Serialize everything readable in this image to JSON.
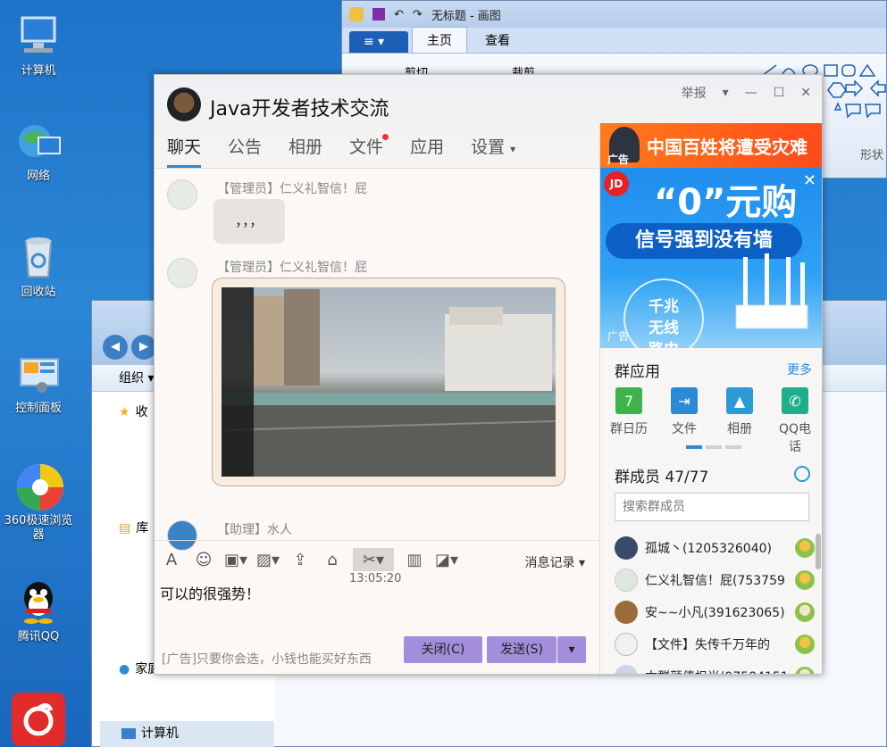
{
  "desktop": {
    "icons": [
      {
        "label": "计算机",
        "icon": "computer-icon"
      },
      {
        "label": "网络",
        "icon": "network-icon"
      },
      {
        "label": "回收站",
        "icon": "recycle-bin-icon"
      },
      {
        "label": "控制面板",
        "icon": "control-panel-icon"
      },
      {
        "label": "360极速浏览器",
        "icon": "browser-360-icon"
      },
      {
        "label": "腾讯QQ",
        "icon": "qq-penguin-icon"
      }
    ]
  },
  "paint": {
    "title": "无标题 - 画图",
    "tabs": [
      "主页",
      "查看"
    ],
    "tools": {
      "cut": "剪切",
      "crop": "裁剪",
      "shapes_label": "形状"
    }
  },
  "explorer": {
    "organize": "组织",
    "nav": [
      "收",
      "库",
      "家庭组",
      "计算机"
    ]
  },
  "qq": {
    "title": "Java开发者技术交流",
    "window": {
      "report": "举报"
    },
    "tabs": [
      "聊天",
      "公告",
      "相册",
      "文件",
      "应用",
      "设置"
    ],
    "messages": [
      {
        "sender": "【管理员】仁义礼智信！屁",
        "text": "，，，"
      },
      {
        "sender": "【管理员】仁义礼智信！屁",
        "text": ""
      },
      {
        "sender": "【助理】水人",
        "text": ""
      }
    ],
    "timestamp": "13:05:20",
    "history_label": "消息记录",
    "draft": "可以的很强势！",
    "ad_line": "[广告]只要你会选，小钱也能买好东西",
    "close_button": "关闭(C)",
    "send_button": "发送(S)",
    "ads": {
      "top_text": "中国百姓将遭受灾难",
      "tag": "广告",
      "jd_logo": "JD",
      "jd_big": "“0”元购",
      "jd_slogan": "信号强到没有墙",
      "jd_circle": "千兆无线路由器"
    },
    "apps": {
      "title": "群应用",
      "more": "更多",
      "items": [
        {
          "label": "群日历",
          "color": "#3db34a"
        },
        {
          "label": "文件",
          "color": "#2b8ad6"
        },
        {
          "label": "相册",
          "color": "#2b9bd6"
        },
        {
          "label": "QQ电话",
          "color": "#1fae8a"
        }
      ]
    },
    "members": {
      "title": "群成员 47/77",
      "search_placeholder": "搜索群成员",
      "list": [
        {
          "name": "孤城丶(1205326040)",
          "avatar_color": "#3a4a6a"
        },
        {
          "name": "仁义礼智信！屁(753759",
          "avatar_color": "#dfe6df"
        },
        {
          "name": "安~~小凡(391623065)",
          "avatar_color": "#9b6b3a"
        },
        {
          "name": "【文件】失传千万年的",
          "avatar_color": "#f1f1f1"
        },
        {
          "name": "本群颜值担当(97584151",
          "avatar_color": "#c9d4e6"
        }
      ]
    }
  }
}
